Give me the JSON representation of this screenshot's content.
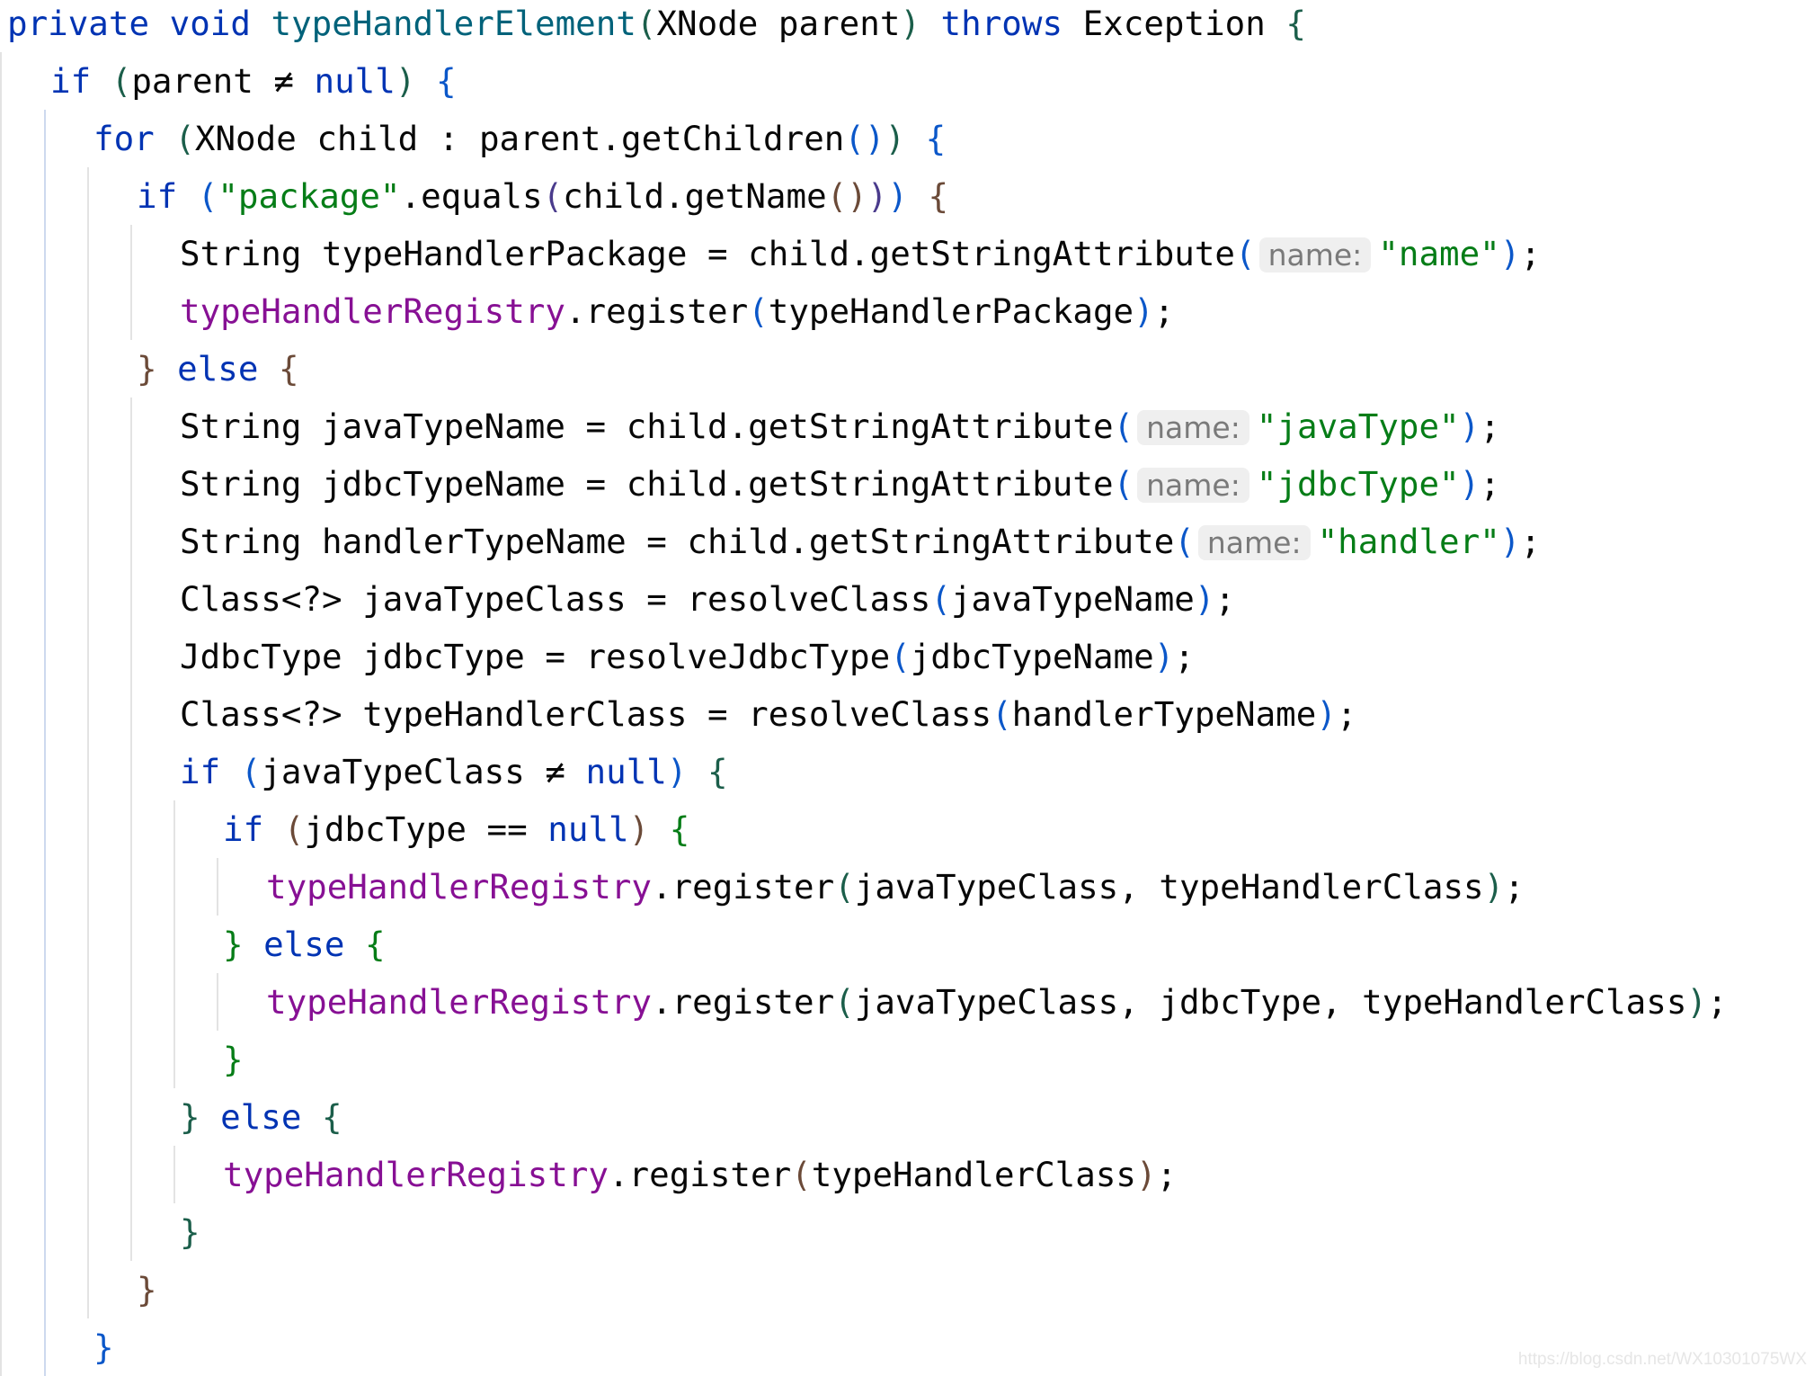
{
  "colors": {
    "keyword": "#0033b3",
    "method": "#00627a",
    "string": "#067d17",
    "field": "#871094",
    "text": "#080808"
  },
  "lines": [
    {
      "indent": 0,
      "tokens": [
        [
          "kw",
          "private void "
        ],
        [
          "fn",
          "typeHandlerElement"
        ],
        [
          "p2",
          "("
        ],
        [
          "",
          "XNode parent"
        ],
        [
          "p2",
          ")"
        ],
        [
          "kw",
          " throws "
        ],
        [
          "",
          "Exception "
        ],
        [
          "p2",
          "{"
        ]
      ]
    },
    {
      "indent": 1,
      "tokens": [
        [
          "kw",
          "if "
        ],
        [
          "p2",
          "("
        ],
        [
          "",
          "parent ≠ "
        ],
        [
          "kw",
          "null"
        ],
        [
          "p2",
          ")"
        ],
        [
          "p1",
          " {"
        ]
      ]
    },
    {
      "indent": 2,
      "tokens": [
        [
          "kw",
          "for "
        ],
        [
          "p2",
          "("
        ],
        [
          "",
          "XNode child : parent.getChildren"
        ],
        [
          "p1",
          "()"
        ],
        [
          "p2",
          ")"
        ],
        [
          "p1",
          " {"
        ]
      ]
    },
    {
      "indent": 3,
      "tokens": [
        [
          "kw",
          "if "
        ],
        [
          "p1",
          "("
        ],
        [
          "str",
          "\"package\""
        ],
        [
          "",
          ".equals"
        ],
        [
          "p4",
          "("
        ],
        [
          "",
          "child.getName"
        ],
        [
          "p3",
          "()"
        ],
        [
          "p4",
          ")"
        ],
        [
          "p1",
          ")"
        ],
        [
          "p3",
          " {"
        ]
      ]
    },
    {
      "indent": 4,
      "tokens": [
        [
          "",
          "String typeHandlerPackage = child.getStringAttribute"
        ],
        [
          "p1",
          "("
        ],
        [
          "hint",
          "name:"
        ],
        [
          "str",
          "\"name\""
        ],
        [
          "p1",
          ")"
        ],
        [
          "",
          ";"
        ]
      ]
    },
    {
      "indent": 4,
      "tokens": [
        [
          "fld",
          "typeHandlerRegistry"
        ],
        [
          "",
          ".register"
        ],
        [
          "p1",
          "("
        ],
        [
          "",
          "typeHandlerPackage"
        ],
        [
          "p1",
          ")"
        ],
        [
          "",
          ";"
        ]
      ]
    },
    {
      "indent": 3,
      "tokens": [
        [
          "p3",
          "}"
        ],
        [
          "kw",
          " else "
        ],
        [
          "p3",
          "{"
        ]
      ]
    },
    {
      "indent": 4,
      "tokens": [
        [
          "",
          "String javaTypeName = child.getStringAttribute"
        ],
        [
          "p1",
          "("
        ],
        [
          "hint",
          "name:"
        ],
        [
          "str",
          "\"javaType\""
        ],
        [
          "p1",
          ")"
        ],
        [
          "",
          ";"
        ]
      ]
    },
    {
      "indent": 4,
      "tokens": [
        [
          "",
          "String jdbcTypeName = child.getStringAttribute"
        ],
        [
          "p1",
          "("
        ],
        [
          "hint",
          "name:"
        ],
        [
          "str",
          "\"jdbcType\""
        ],
        [
          "p1",
          ")"
        ],
        [
          "",
          ";"
        ]
      ]
    },
    {
      "indent": 4,
      "tokens": [
        [
          "",
          "String handlerTypeName = child.getStringAttribute"
        ],
        [
          "p1",
          "("
        ],
        [
          "hint",
          "name:"
        ],
        [
          "str",
          "\"handler\""
        ],
        [
          "p1",
          ")"
        ],
        [
          "",
          ";"
        ]
      ]
    },
    {
      "indent": 4,
      "tokens": [
        [
          "",
          "Class<?> javaTypeClass = resolveClass"
        ],
        [
          "p1",
          "("
        ],
        [
          "",
          "javaTypeName"
        ],
        [
          "p1",
          ")"
        ],
        [
          "",
          ";"
        ]
      ]
    },
    {
      "indent": 4,
      "tokens": [
        [
          "",
          "JdbcType jdbcType = resolveJdbcType"
        ],
        [
          "p1",
          "("
        ],
        [
          "",
          "jdbcTypeName"
        ],
        [
          "p1",
          ")"
        ],
        [
          "",
          ";"
        ]
      ]
    },
    {
      "indent": 4,
      "tokens": [
        [
          "",
          "Class<?> typeHandlerClass = resolveClass"
        ],
        [
          "p1",
          "("
        ],
        [
          "",
          "handlerTypeName"
        ],
        [
          "p1",
          ")"
        ],
        [
          "",
          ";"
        ]
      ]
    },
    {
      "indent": 4,
      "tokens": [
        [
          "kw",
          "if "
        ],
        [
          "p1",
          "("
        ],
        [
          "",
          "javaTypeClass ≠ "
        ],
        [
          "kw",
          "null"
        ],
        [
          "p1",
          ")"
        ],
        [
          "p2",
          " {"
        ]
      ]
    },
    {
      "indent": 5,
      "tokens": [
        [
          "kw",
          "if "
        ],
        [
          "p3",
          "("
        ],
        [
          "",
          "jdbcType == "
        ],
        [
          "kw",
          "null"
        ],
        [
          "p3",
          ")"
        ],
        [
          "str",
          " {"
        ]
      ]
    },
    {
      "indent": 6,
      "tokens": [
        [
          "fld",
          "typeHandlerRegistry"
        ],
        [
          "",
          ".register"
        ],
        [
          "p2",
          "("
        ],
        [
          "",
          "javaTypeClass, typeHandlerClass"
        ],
        [
          "p2",
          ")"
        ],
        [
          "",
          ";"
        ]
      ]
    },
    {
      "indent": 5,
      "tokens": [
        [
          "str",
          "}"
        ],
        [
          "kw",
          " else "
        ],
        [
          "str",
          "{"
        ]
      ]
    },
    {
      "indent": 6,
      "tokens": [
        [
          "fld",
          "typeHandlerRegistry"
        ],
        [
          "",
          ".register"
        ],
        [
          "p2",
          "("
        ],
        [
          "",
          "javaTypeClass, jdbcType, typeHandlerClass"
        ],
        [
          "p2",
          ")"
        ],
        [
          "",
          ";"
        ]
      ]
    },
    {
      "indent": 5,
      "tokens": [
        [
          "str",
          "}"
        ]
      ]
    },
    {
      "indent": 4,
      "tokens": [
        [
          "p2",
          "}"
        ],
        [
          "kw",
          " else "
        ],
        [
          "p2",
          "{"
        ]
      ]
    },
    {
      "indent": 5,
      "tokens": [
        [
          "fld",
          "typeHandlerRegistry"
        ],
        [
          "",
          ".register"
        ],
        [
          "p3",
          "("
        ],
        [
          "",
          "typeHandlerClass"
        ],
        [
          "p3",
          ")"
        ],
        [
          "",
          ";"
        ]
      ]
    },
    {
      "indent": 4,
      "tokens": [
        [
          "p2",
          "}"
        ]
      ]
    },
    {
      "indent": 3,
      "tokens": [
        [
          "p3",
          "}"
        ]
      ]
    },
    {
      "indent": 2,
      "tokens": [
        [
          "p1",
          "}"
        ]
      ]
    }
  ],
  "watermark": "https://blog.csdn.net/WX10301075WX"
}
